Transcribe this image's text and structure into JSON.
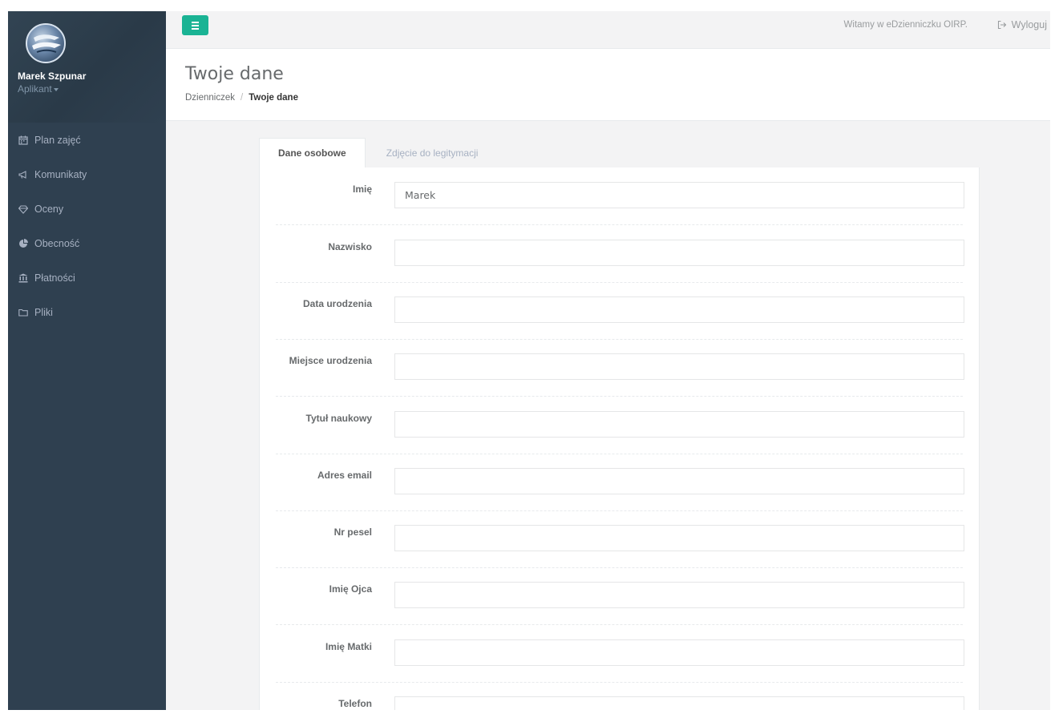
{
  "user": {
    "name": "Marek Szpunar",
    "role": "Aplikant"
  },
  "sidebar": {
    "items": [
      {
        "label": "Plan zajęć",
        "icon": "calendar-icon"
      },
      {
        "label": "Komunikaty",
        "icon": "bullhorn-icon"
      },
      {
        "label": "Oceny",
        "icon": "diamond-icon"
      },
      {
        "label": "Obecność",
        "icon": "pie-chart-icon"
      },
      {
        "label": "Płatności",
        "icon": "bank-icon"
      },
      {
        "label": "Pliki",
        "icon": "folder-icon"
      }
    ]
  },
  "topbar": {
    "welcome": "Witamy w eDzienniczku OIRP.",
    "logout": "Wyloguj"
  },
  "page": {
    "title": "Twoje dane",
    "breadcrumb": {
      "home": "Dzienniczek",
      "separator": "/",
      "current": "Twoje dane"
    }
  },
  "tabs": [
    {
      "label": "Dane osobowe",
      "active": true
    },
    {
      "label": "Zdjęcie do legitymacji",
      "active": false
    }
  ],
  "form": {
    "fields": [
      {
        "label": "Imię",
        "value": "Marek"
      },
      {
        "label": "Nazwisko",
        "value": ""
      },
      {
        "label": "Data urodzenia",
        "value": ""
      },
      {
        "label": "Miejsce urodzenia",
        "value": ""
      },
      {
        "label": "Tytuł naukowy",
        "value": ""
      },
      {
        "label": "Adres email",
        "value": ""
      },
      {
        "label": "Nr pesel",
        "value": ""
      },
      {
        "label": "Imię Ojca",
        "value": ""
      },
      {
        "label": "Imię Matki",
        "value": ""
      },
      {
        "label": "Telefon",
        "value": ""
      }
    ]
  },
  "colors": {
    "sidebar": "#2f4050",
    "accent": "#1ab394",
    "background": "#f3f3f4"
  }
}
